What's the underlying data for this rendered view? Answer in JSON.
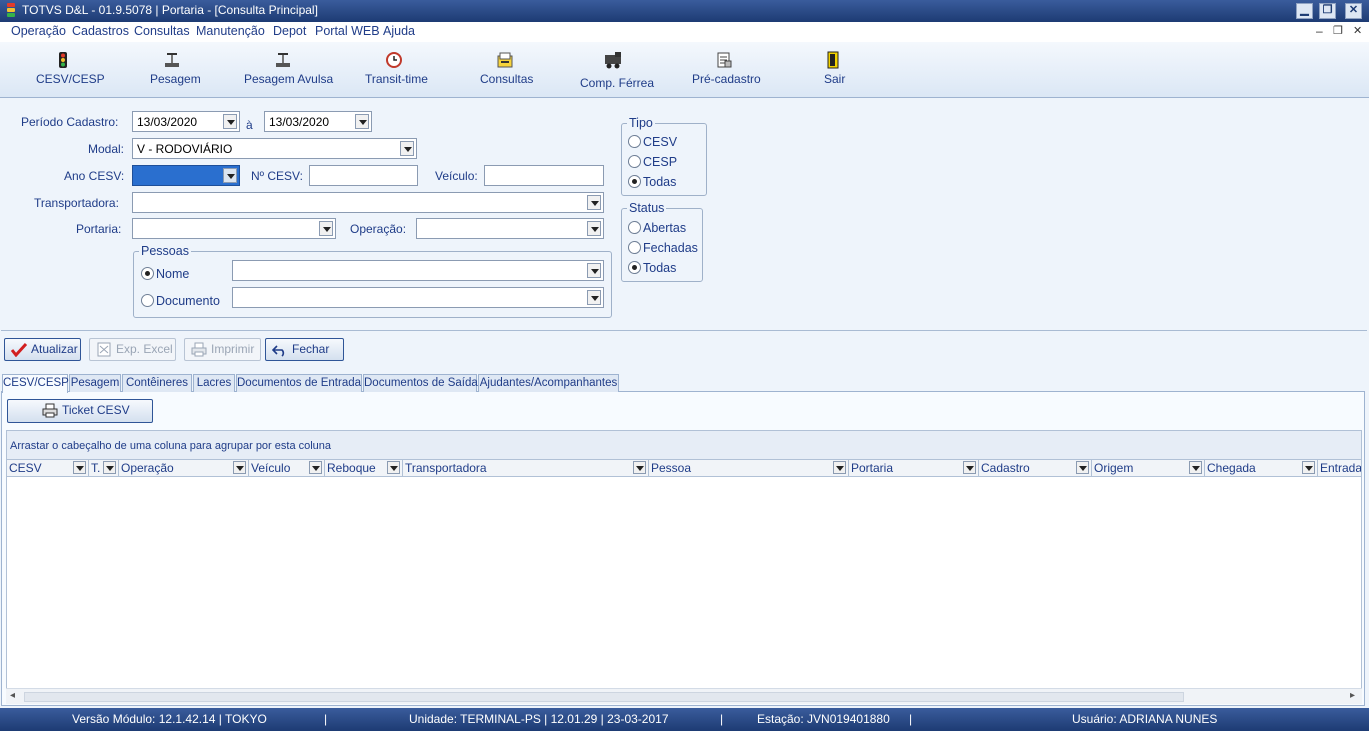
{
  "window": {
    "title": "TOTVS D&L - 01.9.5078 | Portaria - [Consulta Principal]",
    "controls": {
      "minimize": "▁",
      "restore": "❐",
      "close": "✕"
    },
    "mdi_controls": {
      "minimize": "–",
      "restore": "❐",
      "close": "✕"
    }
  },
  "menu": {
    "items": [
      {
        "label": "Operação"
      },
      {
        "label": "Cadastros"
      },
      {
        "label": "Consultas"
      },
      {
        "label": "Manutenção"
      },
      {
        "label": "Depot"
      },
      {
        "label": "Portal WEB"
      },
      {
        "label": "Ajuda"
      }
    ]
  },
  "toolbar": {
    "items": [
      {
        "label": "CESV/CESP",
        "icon": "traffic-light-icon"
      },
      {
        "label": "Pesagem",
        "icon": "scale-icon"
      },
      {
        "label": "Pesagem Avulsa",
        "icon": "scale-icon"
      },
      {
        "label": "Transit-time",
        "icon": "clock-icon"
      },
      {
        "label": "Consultas",
        "icon": "documents-icon"
      },
      {
        "label": "Comp. Férrea",
        "icon": "train-icon"
      },
      {
        "label": "Pré-cadastro",
        "icon": "form-icon"
      },
      {
        "label": "Sair",
        "icon": "exit-door-icon"
      }
    ]
  },
  "filters": {
    "periodo_label": "Período Cadastro:",
    "periodo_inicio": "13/03/2020",
    "periodo_sep": "à",
    "periodo_fim": "13/03/2020",
    "modal_label": "Modal:",
    "modal_value": "V - RODOVIÁRIO",
    "ano_label": "Ano CESV:",
    "ano_value": "",
    "numero_label": "Nº CESV:",
    "numero_value": "",
    "veiculo_label": "Veículo:",
    "veiculo_value": "",
    "transportadora_label": "Transportadora:",
    "transportadora_value": "",
    "portaria_label": "Portaria:",
    "portaria_value": "",
    "operacao_label": "Operação:",
    "operacao_value": "",
    "pessoas": {
      "title": "Pessoas",
      "nome_label": "Nome",
      "nome_selected": true,
      "nome_value": "",
      "documento_label": "Documento",
      "documento_selected": false,
      "documento_value": ""
    },
    "tipo": {
      "title": "Tipo",
      "options": [
        {
          "label": "CESV",
          "selected": false
        },
        {
          "label": "CESP",
          "selected": false
        },
        {
          "label": "Todas",
          "selected": true
        }
      ]
    },
    "status": {
      "title": "Status",
      "options": [
        {
          "label": "Abertas",
          "selected": false
        },
        {
          "label": "Fechadas",
          "selected": false
        },
        {
          "label": "Todas",
          "selected": true
        }
      ]
    }
  },
  "actions": {
    "atualizar": "Atualizar",
    "exp_excel": "Exp. Excel",
    "imprimir": "Imprimir",
    "fechar": "Fechar"
  },
  "tabs": [
    {
      "label": "CESV/CESP",
      "active": true
    },
    {
      "label": "Pesagem",
      "active": false
    },
    {
      "label": "Contêineres",
      "active": false
    },
    {
      "label": "Lacres",
      "active": false
    },
    {
      "label": "Documentos de Entrada",
      "active": false
    },
    {
      "label": "Documentos de Saída",
      "active": false
    },
    {
      "label": "Ajudantes/Acompanhantes",
      "active": false
    }
  ],
  "ticket_button": "Ticket CESV",
  "grid": {
    "group_hint": "Arrastar o cabeçalho de uma coluna para agrupar por esta coluna",
    "columns": [
      "CESV",
      "T.",
      "Operação",
      "Veículo",
      "Reboque",
      "Transportadora",
      "Pessoa",
      "Portaria",
      "Cadastro",
      "Origem",
      "Chegada",
      "Entrada"
    ],
    "rows": []
  },
  "statusbar": {
    "versao": "Versão Módulo:  12.1.42.14  |  TOKYO",
    "unidade": "Unidade: TERMINAL-PS | 12.01.29 | 23-03-2017",
    "estacao": "Estação: JVN019401880",
    "usuario": "Usuário: ADRIANA NUNES",
    "separator": "|"
  }
}
